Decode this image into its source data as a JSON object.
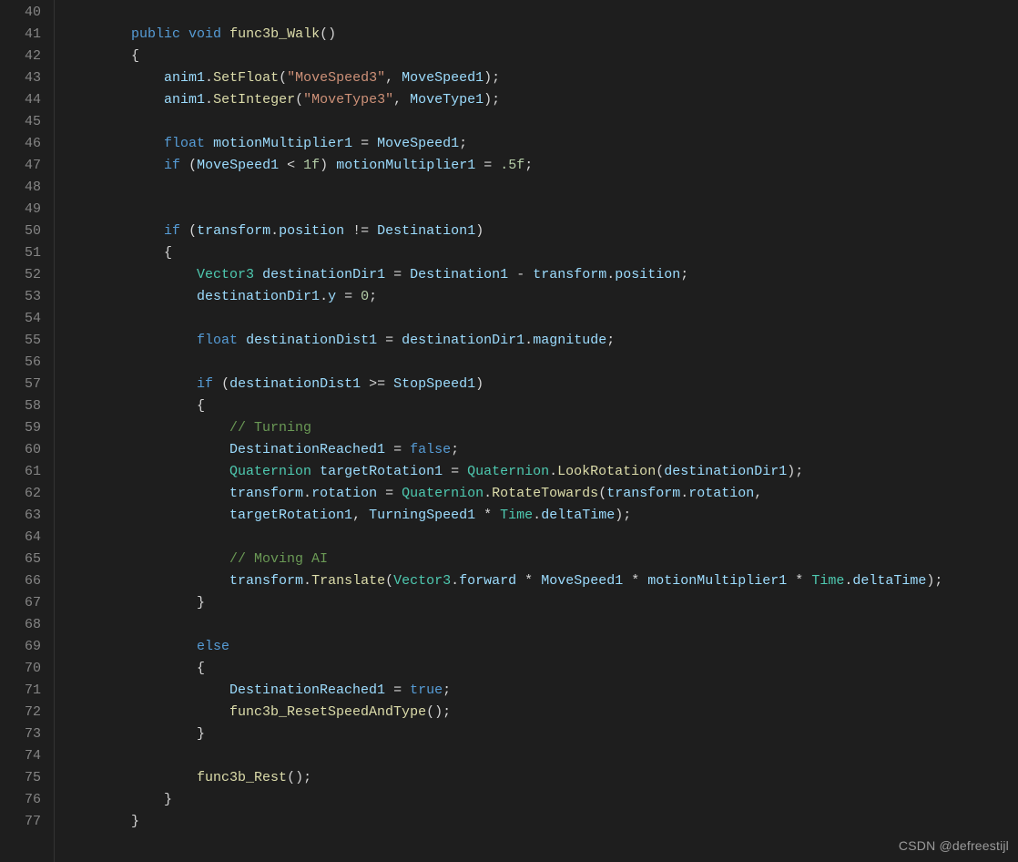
{
  "watermark": "CSDN @defreestijl",
  "gutter_start": 40,
  "lines": [
    {
      "n": 40,
      "indent": 2,
      "tokens": []
    },
    {
      "n": 41,
      "indent": 2,
      "tokens": [
        {
          "t": "kw",
          "v": "public"
        },
        {
          "t": "sp",
          "v": " "
        },
        {
          "t": "kw",
          "v": "void"
        },
        {
          "t": "sp",
          "v": " "
        },
        {
          "t": "func",
          "v": "func3b_Walk"
        },
        {
          "t": "paren",
          "v": "()"
        }
      ]
    },
    {
      "n": 42,
      "indent": 2,
      "tokens": [
        {
          "t": "brace",
          "v": "{"
        }
      ]
    },
    {
      "n": 43,
      "indent": 3,
      "tokens": [
        {
          "t": "field",
          "v": "anim1"
        },
        {
          "t": "punc",
          "v": "."
        },
        {
          "t": "func",
          "v": "SetFloat"
        },
        {
          "t": "paren",
          "v": "("
        },
        {
          "t": "str",
          "v": "\"MoveSpeed3\""
        },
        {
          "t": "punc",
          "v": ", "
        },
        {
          "t": "field",
          "v": "MoveSpeed1"
        },
        {
          "t": "paren",
          "v": ")"
        },
        {
          "t": "punc",
          "v": ";"
        }
      ]
    },
    {
      "n": 44,
      "indent": 3,
      "tokens": [
        {
          "t": "field",
          "v": "anim1"
        },
        {
          "t": "punc",
          "v": "."
        },
        {
          "t": "func",
          "v": "SetInteger"
        },
        {
          "t": "paren",
          "v": "("
        },
        {
          "t": "str",
          "v": "\"MoveType3\""
        },
        {
          "t": "punc",
          "v": ", "
        },
        {
          "t": "field",
          "v": "MoveType1"
        },
        {
          "t": "paren",
          "v": ")"
        },
        {
          "t": "punc",
          "v": ";"
        }
      ]
    },
    {
      "n": 45,
      "indent": 3,
      "tokens": []
    },
    {
      "n": 46,
      "indent": 3,
      "tokens": [
        {
          "t": "kw",
          "v": "float"
        },
        {
          "t": "sp",
          "v": " "
        },
        {
          "t": "field",
          "v": "motionMultiplier1"
        },
        {
          "t": "sp",
          "v": " "
        },
        {
          "t": "op",
          "v": "="
        },
        {
          "t": "sp",
          "v": " "
        },
        {
          "t": "field",
          "v": "MoveSpeed1"
        },
        {
          "t": "punc",
          "v": ";"
        }
      ]
    },
    {
      "n": 47,
      "indent": 3,
      "tokens": [
        {
          "t": "kw",
          "v": "if"
        },
        {
          "t": "sp",
          "v": " "
        },
        {
          "t": "paren",
          "v": "("
        },
        {
          "t": "field",
          "v": "MoveSpeed1"
        },
        {
          "t": "sp",
          "v": " "
        },
        {
          "t": "op",
          "v": "<"
        },
        {
          "t": "sp",
          "v": " "
        },
        {
          "t": "num",
          "v": "1f"
        },
        {
          "t": "paren",
          "v": ")"
        },
        {
          "t": "sp",
          "v": " "
        },
        {
          "t": "field",
          "v": "motionMultiplier1"
        },
        {
          "t": "sp",
          "v": " "
        },
        {
          "t": "op",
          "v": "="
        },
        {
          "t": "sp",
          "v": " "
        },
        {
          "t": "num",
          "v": ".5f"
        },
        {
          "t": "punc",
          "v": ";"
        }
      ]
    },
    {
      "n": 48,
      "indent": 3,
      "tokens": []
    },
    {
      "n": 49,
      "indent": 3,
      "tokens": []
    },
    {
      "n": 50,
      "indent": 3,
      "tokens": [
        {
          "t": "kw",
          "v": "if"
        },
        {
          "t": "sp",
          "v": " "
        },
        {
          "t": "paren",
          "v": "("
        },
        {
          "t": "field",
          "v": "transform"
        },
        {
          "t": "punc",
          "v": "."
        },
        {
          "t": "field",
          "v": "position"
        },
        {
          "t": "sp",
          "v": " "
        },
        {
          "t": "op",
          "v": "!="
        },
        {
          "t": "sp",
          "v": " "
        },
        {
          "t": "field",
          "v": "Destination1"
        },
        {
          "t": "paren",
          "v": ")"
        }
      ]
    },
    {
      "n": 51,
      "indent": 3,
      "tokens": [
        {
          "t": "brace",
          "v": "{"
        }
      ]
    },
    {
      "n": 52,
      "indent": 4,
      "tokens": [
        {
          "t": "type",
          "v": "Vector3"
        },
        {
          "t": "sp",
          "v": " "
        },
        {
          "t": "field",
          "v": "destinationDir1"
        },
        {
          "t": "sp",
          "v": " "
        },
        {
          "t": "op",
          "v": "="
        },
        {
          "t": "sp",
          "v": " "
        },
        {
          "t": "field",
          "v": "Destination1"
        },
        {
          "t": "sp",
          "v": " "
        },
        {
          "t": "op",
          "v": "-"
        },
        {
          "t": "sp",
          "v": " "
        },
        {
          "t": "field",
          "v": "transform"
        },
        {
          "t": "punc",
          "v": "."
        },
        {
          "t": "field",
          "v": "position"
        },
        {
          "t": "punc",
          "v": ";"
        }
      ]
    },
    {
      "n": 53,
      "indent": 4,
      "tokens": [
        {
          "t": "field",
          "v": "destinationDir1"
        },
        {
          "t": "punc",
          "v": "."
        },
        {
          "t": "field",
          "v": "y"
        },
        {
          "t": "sp",
          "v": " "
        },
        {
          "t": "op",
          "v": "="
        },
        {
          "t": "sp",
          "v": " "
        },
        {
          "t": "num",
          "v": "0"
        },
        {
          "t": "punc",
          "v": ";"
        }
      ]
    },
    {
      "n": 54,
      "indent": 4,
      "tokens": []
    },
    {
      "n": 55,
      "indent": 4,
      "tokens": [
        {
          "t": "kw",
          "v": "float"
        },
        {
          "t": "sp",
          "v": " "
        },
        {
          "t": "field",
          "v": "destinationDist1"
        },
        {
          "t": "sp",
          "v": " "
        },
        {
          "t": "op",
          "v": "="
        },
        {
          "t": "sp",
          "v": " "
        },
        {
          "t": "field",
          "v": "destinationDir1"
        },
        {
          "t": "punc",
          "v": "."
        },
        {
          "t": "field",
          "v": "magnitude"
        },
        {
          "t": "punc",
          "v": ";"
        }
      ]
    },
    {
      "n": 56,
      "indent": 4,
      "tokens": []
    },
    {
      "n": 57,
      "indent": 4,
      "tokens": [
        {
          "t": "kw",
          "v": "if"
        },
        {
          "t": "sp",
          "v": " "
        },
        {
          "t": "paren",
          "v": "("
        },
        {
          "t": "field",
          "v": "destinationDist1"
        },
        {
          "t": "sp",
          "v": " "
        },
        {
          "t": "op",
          "v": ">="
        },
        {
          "t": "sp",
          "v": " "
        },
        {
          "t": "field",
          "v": "StopSpeed1"
        },
        {
          "t": "paren",
          "v": ")"
        }
      ]
    },
    {
      "n": 58,
      "indent": 4,
      "tokens": [
        {
          "t": "brace",
          "v": "{"
        }
      ]
    },
    {
      "n": 59,
      "indent": 5,
      "tokens": [
        {
          "t": "cmt",
          "v": "// Turning"
        }
      ]
    },
    {
      "n": 60,
      "indent": 5,
      "tokens": [
        {
          "t": "field",
          "v": "DestinationReached1"
        },
        {
          "t": "sp",
          "v": " "
        },
        {
          "t": "op",
          "v": "="
        },
        {
          "t": "sp",
          "v": " "
        },
        {
          "t": "bool",
          "v": "false"
        },
        {
          "t": "punc",
          "v": ";"
        }
      ]
    },
    {
      "n": 61,
      "indent": 5,
      "tokens": [
        {
          "t": "type",
          "v": "Quaternion"
        },
        {
          "t": "sp",
          "v": " "
        },
        {
          "t": "field",
          "v": "targetRotation1"
        },
        {
          "t": "sp",
          "v": " "
        },
        {
          "t": "op",
          "v": "="
        },
        {
          "t": "sp",
          "v": " "
        },
        {
          "t": "type",
          "v": "Quaternion"
        },
        {
          "t": "punc",
          "v": "."
        },
        {
          "t": "func",
          "v": "LookRotation"
        },
        {
          "t": "paren",
          "v": "("
        },
        {
          "t": "field",
          "v": "destinationDir1"
        },
        {
          "t": "paren",
          "v": ")"
        },
        {
          "t": "punc",
          "v": ";"
        }
      ]
    },
    {
      "n": 62,
      "indent": 5,
      "tokens": [
        {
          "t": "field",
          "v": "transform"
        },
        {
          "t": "punc",
          "v": "."
        },
        {
          "t": "field",
          "v": "rotation"
        },
        {
          "t": "sp",
          "v": " "
        },
        {
          "t": "op",
          "v": "="
        },
        {
          "t": "sp",
          "v": " "
        },
        {
          "t": "type",
          "v": "Quaternion"
        },
        {
          "t": "punc",
          "v": "."
        },
        {
          "t": "func",
          "v": "RotateTowards"
        },
        {
          "t": "paren",
          "v": "("
        },
        {
          "t": "field",
          "v": "transform"
        },
        {
          "t": "punc",
          "v": "."
        },
        {
          "t": "field",
          "v": "rotation"
        },
        {
          "t": "punc",
          "v": ","
        }
      ]
    },
    {
      "n": 63,
      "indent": 5,
      "tokens": [
        {
          "t": "field",
          "v": "targetRotation1"
        },
        {
          "t": "punc",
          "v": ", "
        },
        {
          "t": "field",
          "v": "TurningSpeed1"
        },
        {
          "t": "sp",
          "v": " "
        },
        {
          "t": "op",
          "v": "*"
        },
        {
          "t": "sp",
          "v": " "
        },
        {
          "t": "type",
          "v": "Time"
        },
        {
          "t": "punc",
          "v": "."
        },
        {
          "t": "field",
          "v": "deltaTime"
        },
        {
          "t": "paren",
          "v": ")"
        },
        {
          "t": "punc",
          "v": ";"
        }
      ]
    },
    {
      "n": 64,
      "indent": 5,
      "tokens": []
    },
    {
      "n": 65,
      "indent": 5,
      "tokens": [
        {
          "t": "cmt",
          "v": "// Moving AI"
        }
      ]
    },
    {
      "n": 66,
      "indent": 5,
      "tokens": [
        {
          "t": "field",
          "v": "transform"
        },
        {
          "t": "punc",
          "v": "."
        },
        {
          "t": "func",
          "v": "Translate"
        },
        {
          "t": "paren",
          "v": "("
        },
        {
          "t": "type",
          "v": "Vector3"
        },
        {
          "t": "punc",
          "v": "."
        },
        {
          "t": "field",
          "v": "forward"
        },
        {
          "t": "sp",
          "v": " "
        },
        {
          "t": "op",
          "v": "*"
        },
        {
          "t": "sp",
          "v": " "
        },
        {
          "t": "field",
          "v": "MoveSpeed1"
        },
        {
          "t": "sp",
          "v": " "
        },
        {
          "t": "op",
          "v": "*"
        },
        {
          "t": "sp",
          "v": " "
        },
        {
          "t": "field",
          "v": "motionMultiplier1"
        },
        {
          "t": "sp",
          "v": " "
        },
        {
          "t": "op",
          "v": "*"
        },
        {
          "t": "sp",
          "v": " "
        },
        {
          "t": "type",
          "v": "Time"
        },
        {
          "t": "punc",
          "v": "."
        },
        {
          "t": "field",
          "v": "deltaTime"
        },
        {
          "t": "paren",
          "v": ")"
        },
        {
          "t": "punc",
          "v": ";"
        }
      ]
    },
    {
      "n": 67,
      "indent": 4,
      "tokens": [
        {
          "t": "brace",
          "v": "}"
        }
      ]
    },
    {
      "n": 68,
      "indent": 4,
      "tokens": []
    },
    {
      "n": 69,
      "indent": 4,
      "tokens": [
        {
          "t": "kw",
          "v": "else"
        }
      ]
    },
    {
      "n": 70,
      "indent": 4,
      "tokens": [
        {
          "t": "brace",
          "v": "{"
        }
      ]
    },
    {
      "n": 71,
      "indent": 5,
      "tokens": [
        {
          "t": "field",
          "v": "DestinationReached1"
        },
        {
          "t": "sp",
          "v": " "
        },
        {
          "t": "op",
          "v": "="
        },
        {
          "t": "sp",
          "v": " "
        },
        {
          "t": "bool",
          "v": "true"
        },
        {
          "t": "punc",
          "v": ";"
        }
      ]
    },
    {
      "n": 72,
      "indent": 5,
      "tokens": [
        {
          "t": "func",
          "v": "func3b_ResetSpeedAndType"
        },
        {
          "t": "paren",
          "v": "()"
        },
        {
          "t": "punc",
          "v": ";"
        }
      ]
    },
    {
      "n": 73,
      "indent": 4,
      "tokens": [
        {
          "t": "brace",
          "v": "}"
        }
      ]
    },
    {
      "n": 74,
      "indent": 4,
      "tokens": []
    },
    {
      "n": 75,
      "indent": 4,
      "tokens": [
        {
          "t": "func",
          "v": "func3b_Rest"
        },
        {
          "t": "paren",
          "v": "()"
        },
        {
          "t": "punc",
          "v": ";"
        }
      ]
    },
    {
      "n": 76,
      "indent": 3,
      "tokens": [
        {
          "t": "brace",
          "v": "}"
        }
      ]
    },
    {
      "n": 77,
      "indent": 2,
      "tokens": [
        {
          "t": "brace",
          "v": "}"
        }
      ]
    }
  ]
}
